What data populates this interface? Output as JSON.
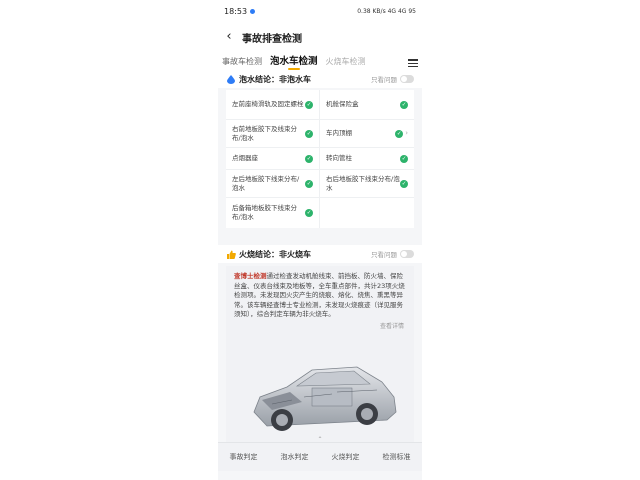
{
  "status_bar": {
    "time": "18:53",
    "right": "0.38 KB/s 4G 4G 95"
  },
  "header": {
    "title": "事故排查检测"
  },
  "tabs": [
    {
      "label": "事故车检测",
      "active": false
    },
    {
      "label": "泡水车检测",
      "active": true
    },
    {
      "label": "火烧车检测",
      "active": false
    }
  ],
  "water": {
    "label": "泡水结论：",
    "value": "非泡水车",
    "toggle_label": "只看问题"
  },
  "water_items": [
    {
      "label": "左前座椅滑轨及固定螺栓",
      "ok": true
    },
    {
      "label": "机舱保险盒",
      "ok": true
    },
    {
      "label": "右前地板胶下及线束分布/泡水",
      "ok": true
    },
    {
      "label": "车内顶棚",
      "ok": true
    },
    {
      "label": "点烟器座",
      "ok": true
    },
    {
      "label": "转向管柱",
      "ok": true
    },
    {
      "label": "左后地板胶下线束分布/泡水",
      "ok": true
    },
    {
      "label": "右后地板胶下线束分布/泡水",
      "ok": true
    },
    {
      "label": "后备箱地板胶下线束分布/泡水",
      "ok": true
    }
  ],
  "fire": {
    "label": "火烧结论：",
    "value": "非火烧车",
    "toggle_label": "只看问题"
  },
  "fire_desc": {
    "highlight": "查博士检测",
    "text": "通过检查发动机舱线束、前挡板、防火墙、保险丝盒、仪表台线束及地板等，全车重点部件，共计23项火烧检测项。未发现因火灾产生的烧痕、熔化、烧焦、熏黑等异常。该车辆经查博士专业检测，未发现火烧痕迹（详见服务须知），综合判定车辆为非火烧车。",
    "view_more": "查看详情"
  },
  "bottom_tabs": [
    "事故判定",
    "泡水判定",
    "火烧判定",
    "检测标准"
  ],
  "colors": {
    "accent": "#f2a900",
    "ok": "#2db36b",
    "highlight": "#c0392b"
  }
}
